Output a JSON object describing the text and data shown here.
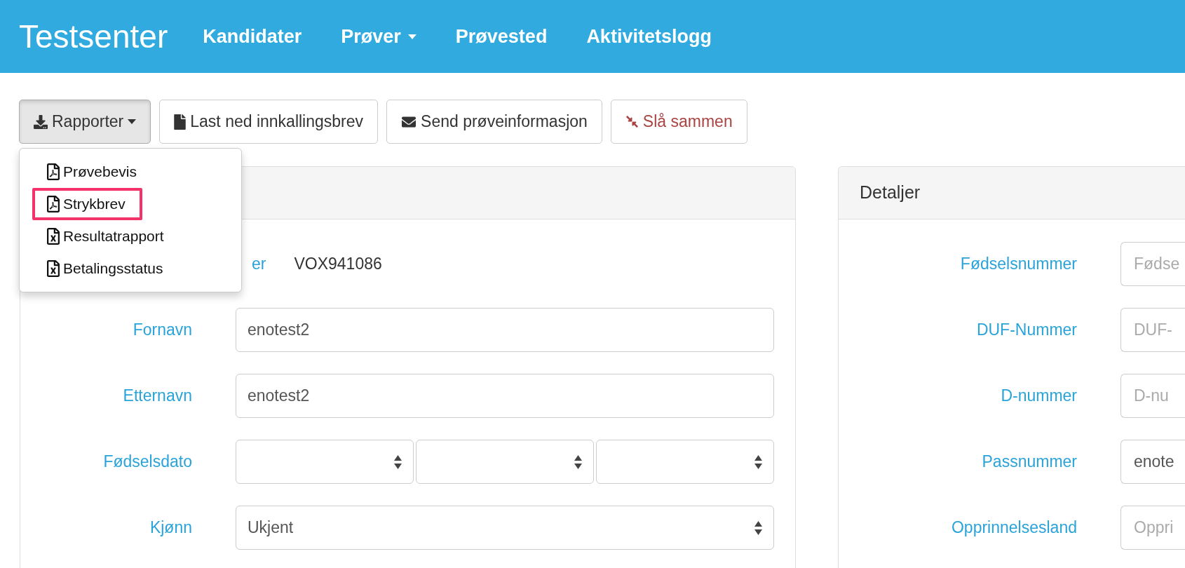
{
  "header": {
    "title": "Testsenter",
    "nav": [
      {
        "label": "Kandidater",
        "kind": "link"
      },
      {
        "label": "Prøver",
        "kind": "dropdown"
      },
      {
        "label": "Prøvested",
        "kind": "link"
      },
      {
        "label": "Aktivitetslogg",
        "kind": "link"
      }
    ]
  },
  "toolbar": [
    {
      "label": "Rapporter",
      "kind": "download",
      "active": true
    },
    {
      "label": "Last ned innkallingsbrev",
      "kind": "file",
      "active": false
    },
    {
      "label": "Send prøveinformasjon",
      "kind": "mail",
      "active": false
    },
    {
      "label": "Slå sammen",
      "kind": "merge",
      "active": false
    }
  ],
  "reports_menu": [
    {
      "label": "Prøvebevis",
      "kind": "pdf",
      "highlighted": false
    },
    {
      "label": "Strykbrev",
      "kind": "pdf",
      "highlighted": true
    },
    {
      "label": "Resultatrapport",
      "kind": "excel",
      "highlighted": false
    },
    {
      "label": "Betalingsstatus",
      "kind": "excel",
      "highlighted": false
    }
  ],
  "left_panel": {
    "rows": [
      {
        "kind": "static",
        "label": "er",
        "value": "VOX941086"
      },
      {
        "kind": "text",
        "label": "Fornavn",
        "value": "enotest2"
      },
      {
        "kind": "text",
        "label": "Etternavn",
        "value": "enotest2"
      },
      {
        "kind": "date",
        "label": "Fødselsdato"
      },
      {
        "kind": "select",
        "label": "Kjønn",
        "value": "Ukjent"
      }
    ]
  },
  "right_panel": {
    "title": "Detaljer",
    "rows": [
      {
        "label": "Fødselsnummer",
        "placeholder": "Fødse"
      },
      {
        "label": "DUF-Nummer",
        "placeholder": "DUF-"
      },
      {
        "label": "D-nummer",
        "placeholder": "D-nu"
      },
      {
        "label": "Passnummer",
        "value": "enote"
      },
      {
        "label": "Opprinnelsesland",
        "placeholder": "Oppri"
      }
    ]
  }
}
